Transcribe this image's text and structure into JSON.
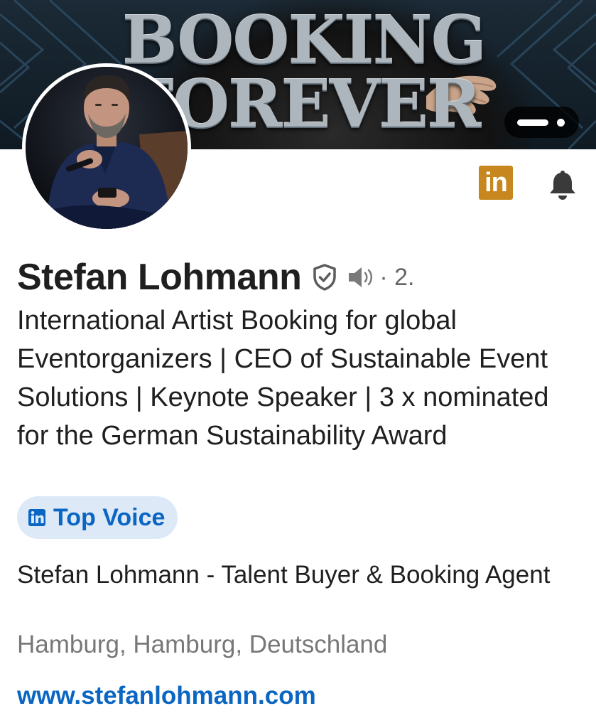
{
  "banner": {
    "title_line1": "BOOKING",
    "title_line2": "FOREVER",
    "carousel_icon": "carousel-pager-icon"
  },
  "profile": {
    "avatar_icon": "profile-photo",
    "name": "Stefan Lohmann",
    "verified_icon": "verified-shield-icon",
    "speaker_icon": "name-pronunciation-speaker-icon",
    "degree": "· 2.",
    "headline": "International Artist Booking for global Eventorganizers | CEO of Sustainable Event Solutions | Keynote Speaker | 3 x nominated for the German Sustainability Award",
    "badge": {
      "icon": "linkedin-icon",
      "label": "Top Voice"
    },
    "company": "Stefan Lohmann - Talent Buyer & Booking Agent",
    "location": "Hamburg, Hamburg, Deutschland",
    "website": "www.stefanlohmann.com"
  },
  "actions": {
    "linkedin_button_label": "in",
    "linkedin_icon": "linkedin-icon",
    "bell_icon": "bell-icon"
  },
  "colors": {
    "linkedin_blue": "#0a66c2",
    "badge_background": "#dde9f7",
    "linkedin_button_gold": "#c8861f",
    "text_primary": "#1f1f1f",
    "text_secondary": "#777777"
  }
}
